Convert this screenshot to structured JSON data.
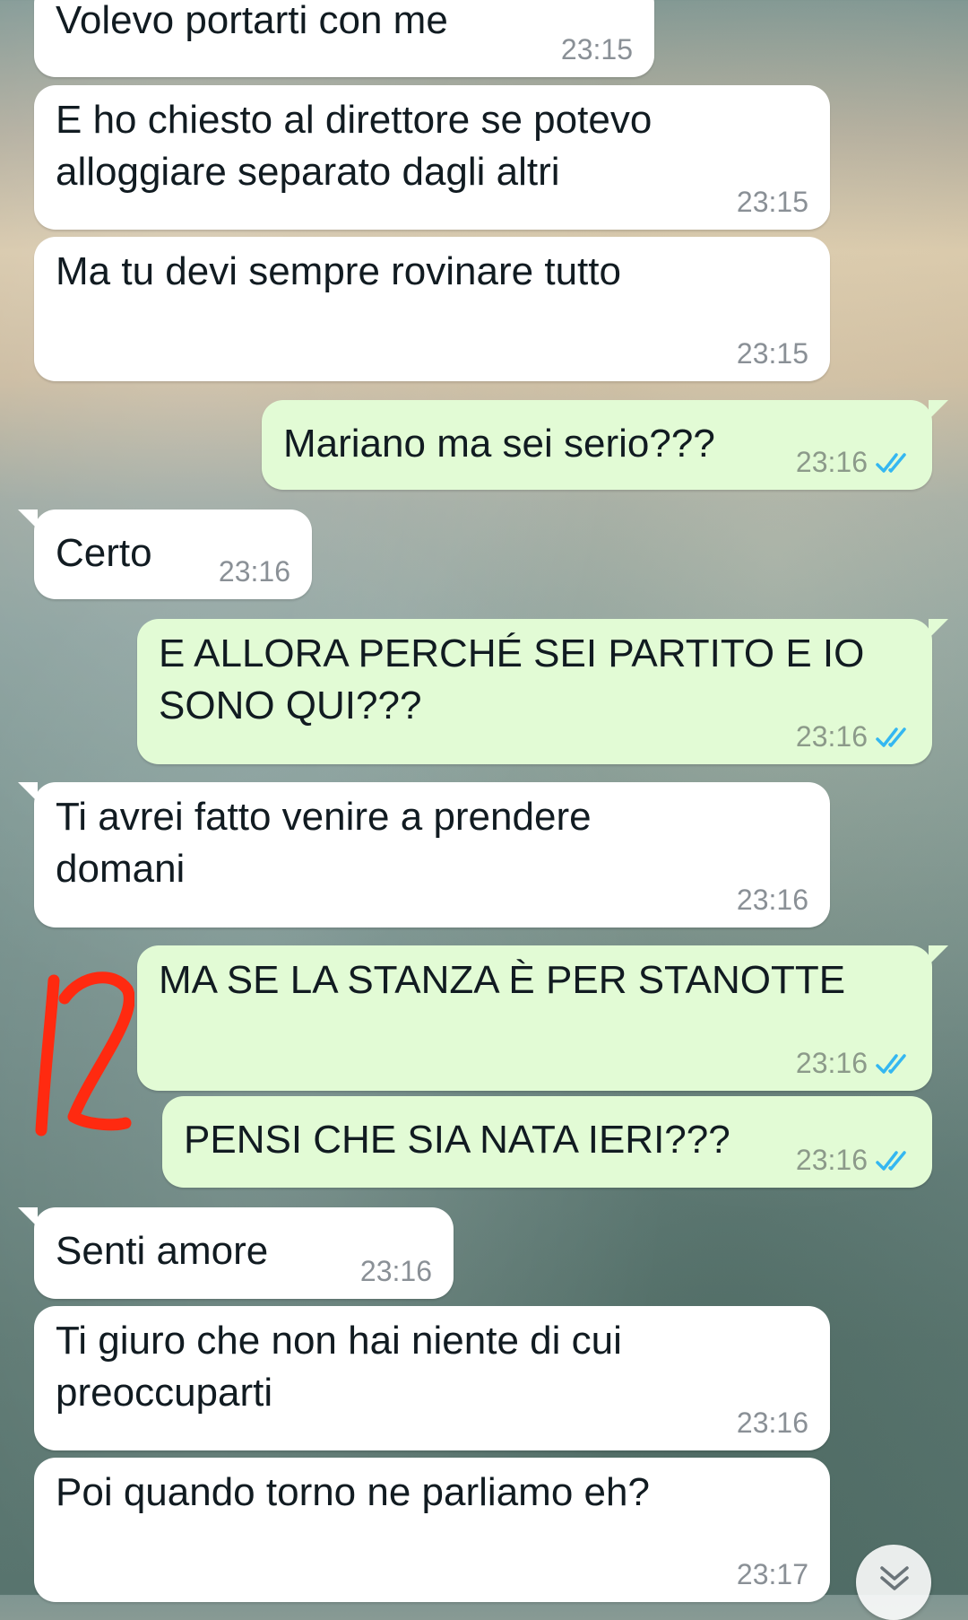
{
  "chat": {
    "messages": [
      {
        "direction": "incoming",
        "text": "Volevo portarti con me",
        "time": "23:15"
      },
      {
        "direction": "incoming",
        "text": "E ho chiesto al direttore se potevo\nalloggiare separato dagli altri",
        "time": "23:15"
      },
      {
        "direction": "incoming",
        "text": "Ma tu devi sempre rovinare tutto",
        "time": "23:15"
      },
      {
        "direction": "outgoing",
        "text": "Mariano ma sei serio???",
        "time": "23:16",
        "status": "read"
      },
      {
        "direction": "incoming",
        "text": "Certo",
        "time": "23:16"
      },
      {
        "direction": "outgoing",
        "text": "E ALLORA PERCHÉ SEI PARTITO E IO\nSONO QUI???",
        "time": "23:16",
        "status": "read"
      },
      {
        "direction": "incoming",
        "text": "Ti avrei fatto venire a prendere\ndomani",
        "time": "23:16"
      },
      {
        "direction": "outgoing",
        "text": "MA SE LA STANZA È PER STANOTTE",
        "time": "23:16",
        "status": "read"
      },
      {
        "direction": "outgoing",
        "text": "PENSI CHE SIA NATA IERI???",
        "time": "23:16",
        "status": "read"
      },
      {
        "direction": "incoming",
        "text": "Senti amore",
        "time": "23:16"
      },
      {
        "direction": "incoming",
        "text": "Ti giuro che non hai niente di cui\npreoccuparti",
        "time": "23:16"
      },
      {
        "direction": "incoming",
        "text": "Poi quando torno ne parliamo eh?",
        "time": "23:17"
      }
    ]
  },
  "annotation": {
    "text": "12",
    "color": "#ff2a10"
  },
  "colors": {
    "incoming_bubble": "#ffffff",
    "outgoing_bubble": "#e2fbd5",
    "read_tick": "#34b7f1",
    "timestamp": "#8a9096"
  },
  "icons": {
    "read_receipt": "double-check-icon",
    "scroll_down": "chevron-double-down-icon"
  }
}
